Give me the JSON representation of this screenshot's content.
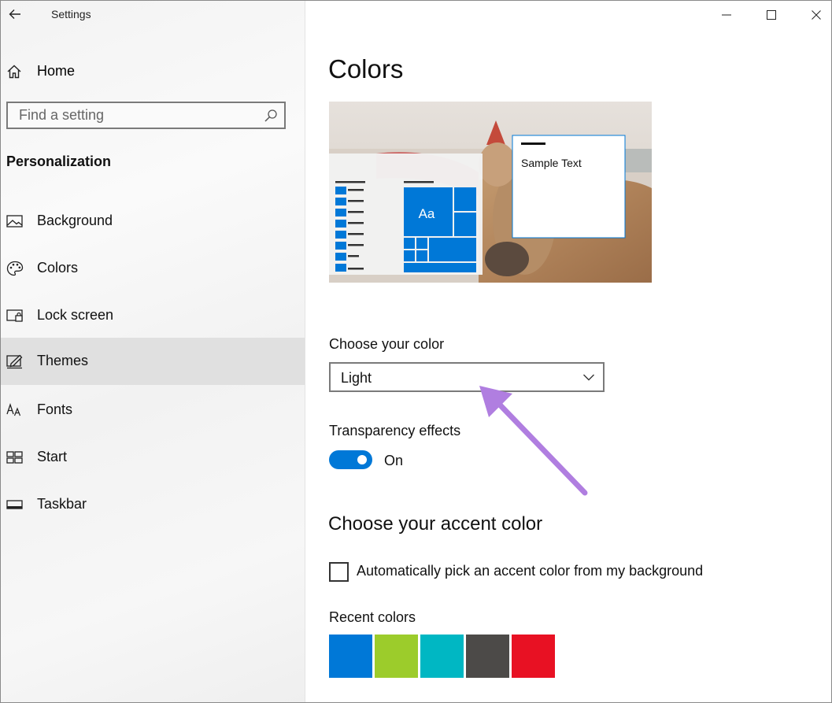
{
  "window": {
    "title": "Settings",
    "back_icon": "back-arrow-icon",
    "controls": [
      "minimize-icon",
      "maximize-icon",
      "close-icon"
    ]
  },
  "sidebar": {
    "home_label": "Home",
    "search": {
      "placeholder": "Find a setting",
      "value": ""
    },
    "section": "Personalization",
    "items": [
      {
        "label": "Background",
        "icon": "picture-icon",
        "selected": false
      },
      {
        "label": "Colors",
        "icon": "palette-icon",
        "selected": false
      },
      {
        "label": "Lock screen",
        "icon": "lock-screen-icon",
        "selected": false
      },
      {
        "label": "Themes",
        "icon": "themes-icon",
        "selected": true
      },
      {
        "label": "Fonts",
        "icon": "fonts-icon",
        "selected": false
      },
      {
        "label": "Start",
        "icon": "start-icon",
        "selected": false
      },
      {
        "label": "Taskbar",
        "icon": "taskbar-icon",
        "selected": false
      }
    ]
  },
  "main": {
    "title": "Colors",
    "preview": {
      "tile_text": "Aa",
      "sample_text": "Sample Text"
    },
    "choose_color": {
      "label": "Choose your color",
      "selected": "Light"
    },
    "transparency": {
      "label": "Transparency effects",
      "state": "On"
    },
    "accent": {
      "heading": "Choose your accent color",
      "auto_pick_label": "Automatically pick an accent color from my background",
      "auto_pick_checked": false,
      "recent_label": "Recent colors",
      "recent_colors": [
        "#0078d7",
        "#9ccc2b",
        "#00b7c3",
        "#4c4a48",
        "#e81123"
      ]
    }
  },
  "colors": {
    "accent": "#0078d7",
    "annotation_arrow": "#b07ee0"
  }
}
